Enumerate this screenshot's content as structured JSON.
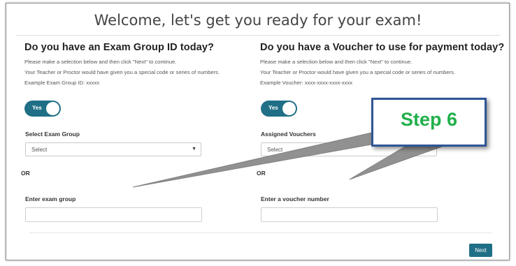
{
  "page": {
    "title": "Welcome, let's get you ready for your exam!"
  },
  "exam_group": {
    "heading": "Do you have an Exam Group ID today?",
    "line1": "Please make a selection below and then click \"Next\" to continue.",
    "line2": "Your Teacher or Proctor would have given you a special code or series of numbers.",
    "line3": "Example Exam Group ID: xxxxx",
    "toggle_label": "Yes",
    "select_label": "Select Exam Group",
    "select_value": "Select",
    "or_label": "OR",
    "input_label": "Enter exam group",
    "input_value": ""
  },
  "voucher": {
    "heading": "Do you have a Voucher to use for payment today?",
    "line1": "Please make a selection below and then click \"Next\" to continue.",
    "line2": "Your Teacher or Proctor would have given you a special code or series of numbers.",
    "line3": "Example Voucher: xxxx-xxxx-xxxx-xxxx",
    "toggle_label": "Yes",
    "select_label": "Assigned Vouchers",
    "select_value": "Select",
    "or_label": "OR",
    "input_label": "Enter a voucher number",
    "input_value": ""
  },
  "actions": {
    "next_label": "Next"
  },
  "callout": {
    "text": "Step 6",
    "text_color": "#22b04b",
    "border_color": "#2f5597",
    "pointer_color": "#8c8c8c"
  },
  "colors": {
    "accent": "#1f6f86"
  }
}
